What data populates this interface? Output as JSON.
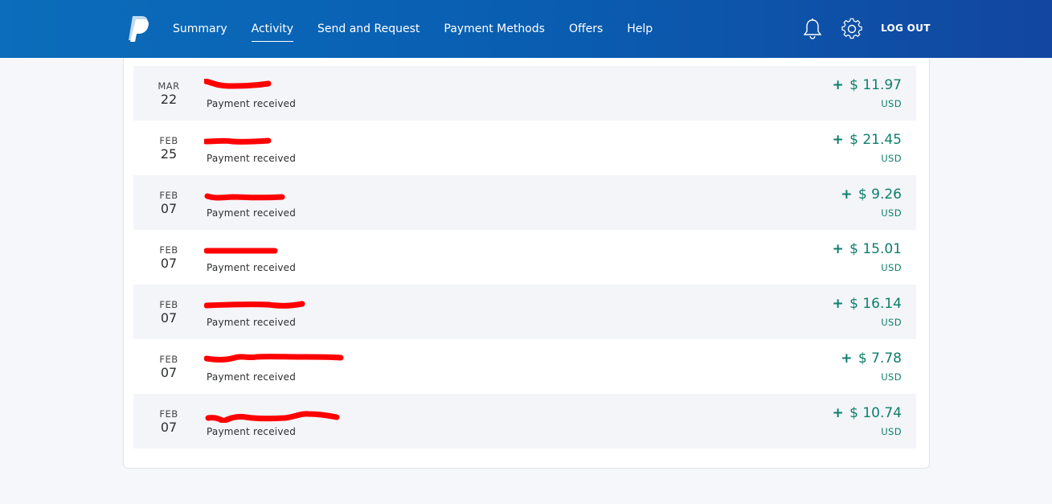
{
  "nav": {
    "items": [
      {
        "label": "Summary",
        "active": false
      },
      {
        "label": "Activity",
        "active": true
      },
      {
        "label": "Send and Request",
        "active": false
      },
      {
        "label": "Payment Methods",
        "active": false
      },
      {
        "label": "Offers",
        "active": false
      },
      {
        "label": "Help",
        "active": false
      }
    ],
    "logout_label": "LOG OUT"
  },
  "icons": {
    "logo": "paypal-logo",
    "notifications": "bell-icon",
    "settings": "gear-icon"
  },
  "colors": {
    "header_start": "#0b6dbb",
    "header_end": "#1246a0",
    "amount_green": "#0e7e6b",
    "redaction_red": "#ff0000"
  },
  "transactions": [
    {
      "month": "MAR",
      "day": "22",
      "description": "Payment received",
      "sign": "+",
      "amount": "$ 11.97",
      "currency": "USD"
    },
    {
      "month": "FEB",
      "day": "25",
      "description": "Payment received",
      "sign": "+",
      "amount": "$ 21.45",
      "currency": "USD"
    },
    {
      "month": "FEB",
      "day": "07",
      "description": "Payment received",
      "sign": "+",
      "amount": "$ 9.26",
      "currency": "USD"
    },
    {
      "month": "FEB",
      "day": "07",
      "description": "Payment received",
      "sign": "+",
      "amount": "$ 15.01",
      "currency": "USD"
    },
    {
      "month": "FEB",
      "day": "07",
      "description": "Payment received",
      "sign": "+",
      "amount": "$ 16.14",
      "currency": "USD"
    },
    {
      "month": "FEB",
      "day": "07",
      "description": "Payment received",
      "sign": "+",
      "amount": "$ 7.78",
      "currency": "USD"
    },
    {
      "month": "FEB",
      "day": "07",
      "description": "Payment received",
      "sign": "+",
      "amount": "$ 10.74",
      "currency": "USD"
    }
  ]
}
